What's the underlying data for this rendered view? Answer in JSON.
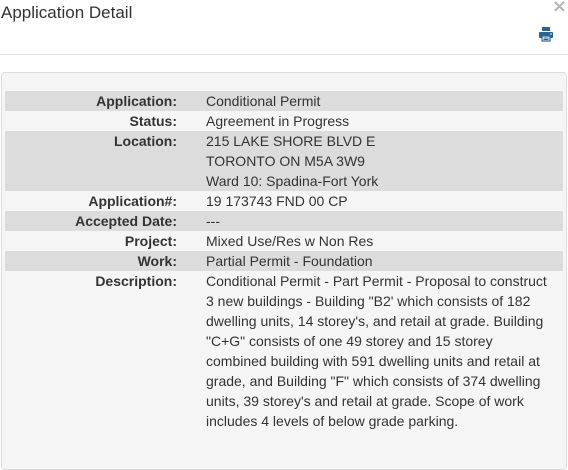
{
  "dialog": {
    "title": "Application Detail",
    "close_glyph": "×",
    "print_icon": "printer-icon"
  },
  "details": {
    "application_label": "Application:",
    "application_value": "Conditional Permit",
    "status_label": "Status:",
    "status_value": "Agreement in Progress",
    "location_label": "Location:",
    "location_lines": [
      "215 LAKE SHORE BLVD E",
      "TORONTO ON M5A 3W9",
      "Ward 10: Spadina-Fort York"
    ],
    "application_number_label": "Application#:",
    "application_number_value": "19 173743 FND 00 CP",
    "accepted_date_label": "Accepted Date:",
    "accepted_date_value": "---",
    "project_label": "Project:",
    "project_value": "Mixed Use/Res w Non Res",
    "work_label": "Work:",
    "work_value": "Partial Permit - Foundation",
    "description_label": "Description:",
    "description_value": "Conditional Permit - Part Permit - Proposal to construct 3 new buildings - Building \"B2' which consists of 182 dwelling units, 14 storey's, and retail at grade. Building \"C+G\" consists of one 49 storey and 15 storey combined building with 591 dwelling units and retail at grade, and Building \"F\" which consists of 374 dwelling units, 39 storey's and retail at grade. Scope of work includes 4 levels of below grade parking."
  },
  "colors": {
    "shaded_row": "#dcdcdc",
    "panel_bg": "#f5f5f5",
    "print_icon": "#2a6496"
  }
}
